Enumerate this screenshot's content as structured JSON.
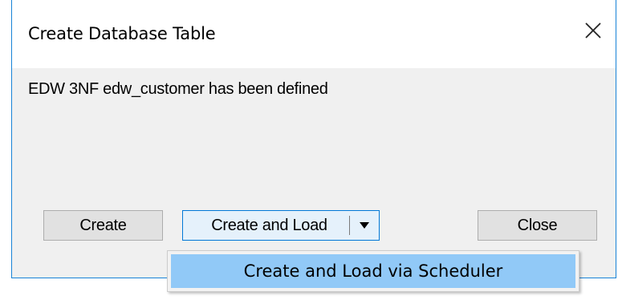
{
  "window": {
    "title": "Create Database Table",
    "close_icon": "close-icon"
  },
  "message": "EDW 3NF edw_customer has been defined",
  "buttons": {
    "create": "Create",
    "create_and_load": "Create and Load",
    "close": "Close"
  },
  "dropdown_menu": {
    "items": [
      {
        "label": "Create and Load via Scheduler",
        "highlighted": true
      }
    ]
  },
  "colors": {
    "window_border": "#1883d7",
    "button_focus_border": "#0078d7",
    "menu_highlight": "#91c9f7",
    "dialog_background": "#f0f0f0"
  }
}
